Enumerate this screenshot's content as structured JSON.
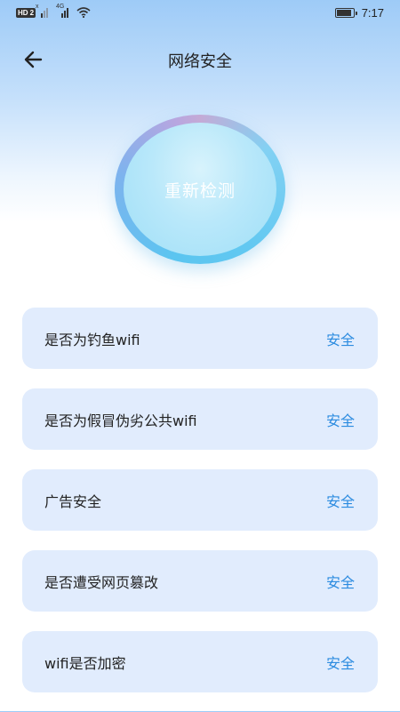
{
  "status_bar": {
    "hd_badge": "HD",
    "sim_badge": "2",
    "signal1_tag": "x",
    "signal2_tag": "4G",
    "time": "7:17"
  },
  "header": {
    "back_icon": "arrow-left-icon",
    "title": "网络安全"
  },
  "detect_button": {
    "label": "重新检测"
  },
  "checks": [
    {
      "label": "是否为钓鱼wifi",
      "status": "安全"
    },
    {
      "label": "是否为假冒伪劣公共wifi",
      "status": "安全"
    },
    {
      "label": "广告安全",
      "status": "安全"
    },
    {
      "label": "是否遭受网页篡改",
      "status": "安全"
    },
    {
      "label": "wifi是否加密",
      "status": "安全"
    }
  ],
  "colors": {
    "accent": "#2b8be0",
    "card_bg": "#e1ecfd"
  }
}
